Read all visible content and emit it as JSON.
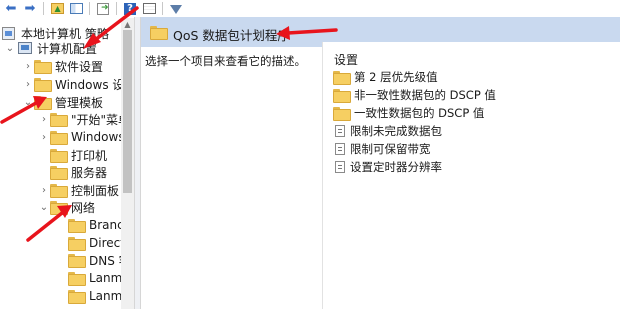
{
  "toolbar": {
    "buttons": [
      {
        "name": "back-arrow-icon",
        "glyph": "⬅",
        "color": "#3a6fc4"
      },
      {
        "name": "forward-arrow-icon",
        "glyph": "➡",
        "color": "#3a6fc4"
      },
      {
        "name": "up-folder-icon",
        "glyph": "▣",
        "color": "#6aa84f"
      },
      {
        "name": "show-hide-tree-icon",
        "glyph": "▦",
        "color": "#4a7bb7"
      },
      {
        "name": "export-list-icon",
        "glyph": "⇲",
        "color": "#4a8f3a"
      },
      {
        "name": "help-icon",
        "glyph": "?",
        "color": "#ffffff"
      },
      {
        "name": "properties-icon",
        "glyph": "▤",
        "color": "#5a5a5a"
      },
      {
        "name": "filter-icon",
        "glyph": "▼",
        "color": "#5c7da8"
      }
    ]
  },
  "tree": {
    "root": "本地计算机 策略",
    "computer_config": "计算机配置",
    "software_settings": "软件设置",
    "windows_settings": "Windows 设置",
    "admin_templates": "管理模板",
    "start_menu": "\"开始\"菜单",
    "windows_components": "Windows",
    "printers": "打印机",
    "server": "服务器",
    "control_panel": "控制面板",
    "network": "网络",
    "branch": "Branch",
    "direct": "Direct",
    "dns": "DNS 客",
    "lanman1": "Lanma",
    "lanman2": "Lanma"
  },
  "header": {
    "title": "QoS 数据包计划程序"
  },
  "description": "选择一个项目来查看它的描述。",
  "settings": {
    "title": "设置",
    "items": [
      {
        "type": "folder",
        "label": "第 2 层优先级值"
      },
      {
        "type": "folder",
        "label": "非一致性数据包的 DSCP 值"
      },
      {
        "type": "folder",
        "label": "一致性数据包的 DSCP 值"
      },
      {
        "type": "policy",
        "label": "限制未完成数据包"
      },
      {
        "type": "policy",
        "label": "限制可保留带宽"
      },
      {
        "type": "policy",
        "label": "设置定时器分辨率"
      }
    ]
  },
  "colors": {
    "header_band": "#c9d9ef",
    "annotation_arrow": "#e8141c",
    "folder_fill": "#f6cf62"
  }
}
